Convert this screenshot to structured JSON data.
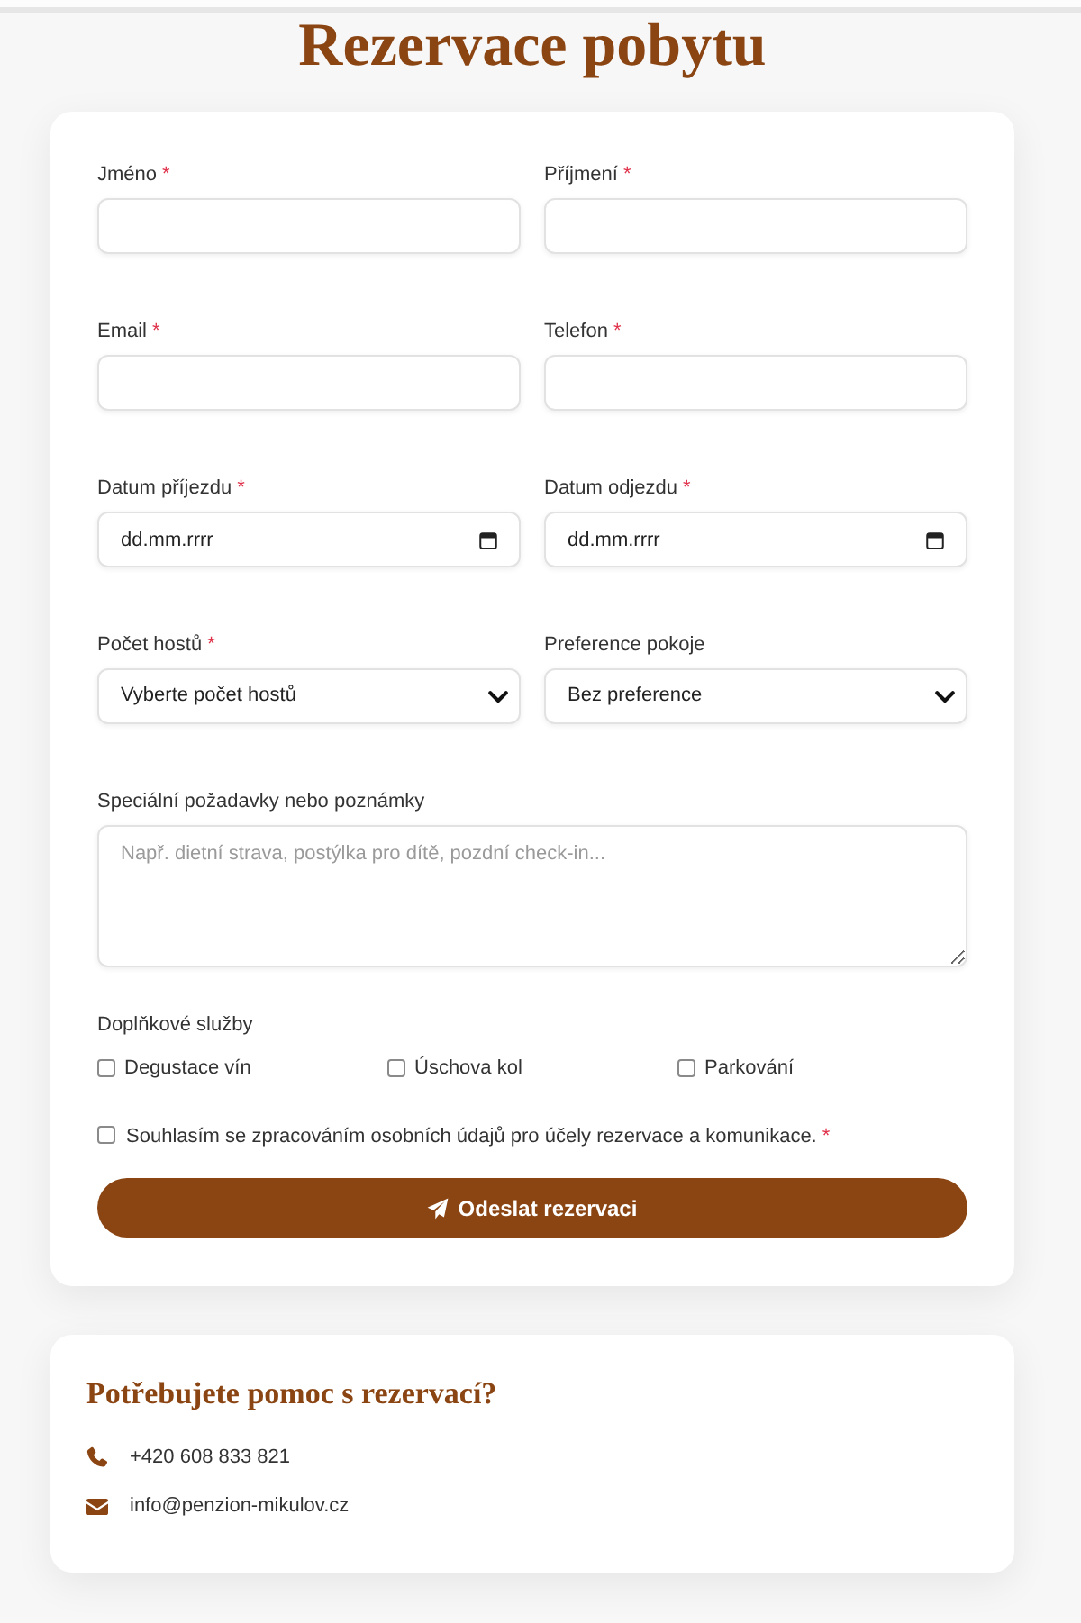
{
  "title": "Rezervace pobytu",
  "form": {
    "fields": [
      {
        "kind": "text",
        "label": "Jméno",
        "required_mark": "*"
      },
      {
        "kind": "text",
        "label": "Příjmení",
        "required_mark": "*"
      },
      {
        "kind": "text",
        "label": "Email",
        "required_mark": "*"
      },
      {
        "kind": "text",
        "label": "Telefon",
        "required_mark": "*"
      },
      {
        "kind": "date",
        "label": "Datum příjezdu",
        "required_mark": "*",
        "placeholder": "dd.mm.rrrr"
      },
      {
        "kind": "date",
        "label": "Datum odjezdu",
        "required_mark": "*",
        "placeholder": "dd.mm.rrrr"
      },
      {
        "kind": "select",
        "label": "Počet hostů",
        "required_mark": "*",
        "value": "Vyberte počet hostů"
      },
      {
        "kind": "select",
        "label": "Preference pokoje",
        "value": "Bez preference"
      },
      {
        "kind": "textarea",
        "label": "Speciální požadavky nebo poznámky",
        "placeholder": "Např. dietní strava, postýlka pro dítě, pozdní check-in..."
      }
    ],
    "services": {
      "label": "Doplňkové služby",
      "options": [
        {
          "label": "Degustace vín",
          "checked": false
        },
        {
          "label": "Úschova kol",
          "checked": false
        },
        {
          "label": "Parkování",
          "checked": false
        }
      ]
    },
    "consent": {
      "label": "Souhlasím se zpracováním osobních údajů pro účely rezervace a komunikace.",
      "required_mark": "*",
      "checked": false
    },
    "submit": {
      "label": "Odeslat rezervaci"
    }
  },
  "help": {
    "title": "Potřebujete pomoc s rezervací?",
    "contacts": [
      {
        "kind": "phone",
        "text": "+420 608 833 821"
      },
      {
        "kind": "email",
        "text": "info@penzion-mikulov.cz"
      }
    ]
  }
}
